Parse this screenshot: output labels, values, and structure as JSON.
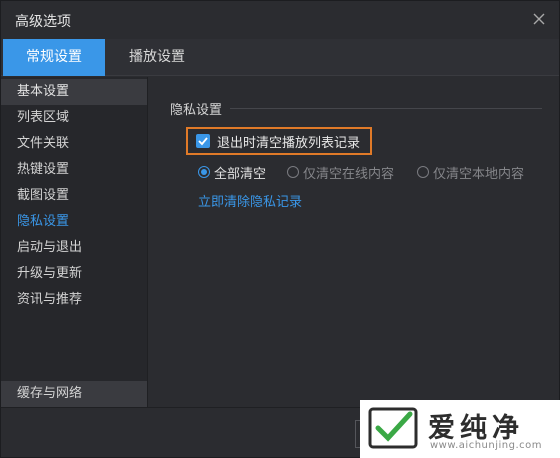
{
  "window": {
    "title": "高级选项"
  },
  "tabs": [
    {
      "label": "常规设置",
      "active": true
    },
    {
      "label": "播放设置",
      "active": false
    }
  ],
  "sidebar": {
    "items": [
      {
        "label": "基本设置"
      },
      {
        "label": "列表区域"
      },
      {
        "label": "文件关联"
      },
      {
        "label": "热键设置"
      },
      {
        "label": "截图设置"
      },
      {
        "label": "隐私设置",
        "selected": true
      },
      {
        "label": "启动与退出"
      },
      {
        "label": "升级与更新"
      },
      {
        "label": "资讯与推荐"
      }
    ],
    "bottom_item": "缓存与网络"
  },
  "privacy": {
    "section_title": "隐私设置",
    "clear_on_exit": {
      "label": "退出时清空播放列表记录",
      "checked": true
    },
    "radio_options": [
      {
        "label": "全部清空",
        "selected": true
      },
      {
        "label": "仅清空在线内容",
        "selected": false
      },
      {
        "label": "仅清空本地内容",
        "selected": false
      }
    ],
    "clear_now_link": "立即清除隐私记录"
  },
  "watermark": {
    "text": "爱纯净",
    "url": "www.aichunjing.com"
  },
  "colors": {
    "accent": "#3a97e8",
    "highlight_box": "#e07a28",
    "background": "#2b2c30",
    "sidebar_bg": "#26272b"
  }
}
